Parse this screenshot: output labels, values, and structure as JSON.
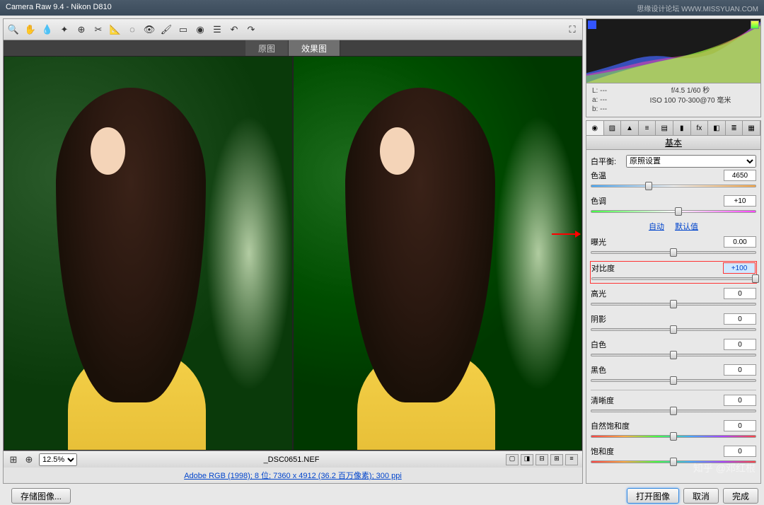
{
  "title": "Camera Raw 9.4  -  Nikon D810",
  "watermark_top": "思缘设计论坛  WWW.MISSYUAN.COM",
  "watermark_bottom": "知乎 @邓红根",
  "toolbar_icons": [
    "zoom",
    "hand",
    "eyedropper",
    "color-sampler",
    "target",
    "crop",
    "straighten",
    "spot",
    "redeye",
    "brush",
    "gradient",
    "radial",
    "prefs",
    "rotate-ccw",
    "rotate-cw"
  ],
  "tabs": {
    "original": "原图",
    "effect": "效果图"
  },
  "status": {
    "zoom": "12.5%",
    "filename": "_DSC0651.NEF"
  },
  "info_link": "Adobe RGB (1998); 8 位; 7360 x 4912 (36.2 百万像素); 300 ppi",
  "meta": {
    "L": "L:  ---",
    "a": "a:  ---",
    "b": "b:  ---",
    "exposure": "f/4.5  1/60 秒",
    "iso": "ISO 100  70-300@70 毫米"
  },
  "panel_tabs": [
    "◉",
    "▨",
    "▲",
    "≡",
    "▤",
    "▮",
    "fx",
    "◧",
    "≣",
    "▦"
  ],
  "panel_title": "基本",
  "white_balance": {
    "label": "白平衡:",
    "value": "原照设置"
  },
  "sliders": {
    "temp": {
      "name": "色温",
      "value": "4650",
      "pos": 35
    },
    "tint": {
      "name": "色调",
      "value": "+10",
      "pos": 53
    },
    "exposure": {
      "name": "曝光",
      "value": "0.00",
      "pos": 50
    },
    "contrast": {
      "name": "对比度",
      "value": "+100",
      "pos": 100
    },
    "highlights": {
      "name": "高光",
      "value": "0",
      "pos": 50
    },
    "shadows": {
      "name": "阴影",
      "value": "0",
      "pos": 50
    },
    "whites": {
      "name": "白色",
      "value": "0",
      "pos": 50
    },
    "blacks": {
      "name": "黑色",
      "value": "0",
      "pos": 50
    },
    "clarity": {
      "name": "清晰度",
      "value": "0",
      "pos": 50
    },
    "vibrance": {
      "name": "自然饱和度",
      "value": "0",
      "pos": 50
    },
    "saturation": {
      "name": "饱和度",
      "value": "0",
      "pos": 50
    }
  },
  "links": {
    "auto": "自动",
    "default": "默认值"
  },
  "buttons": {
    "save_image": "存储图像...",
    "open": "打开图像",
    "cancel": "取消",
    "done": "完成"
  }
}
